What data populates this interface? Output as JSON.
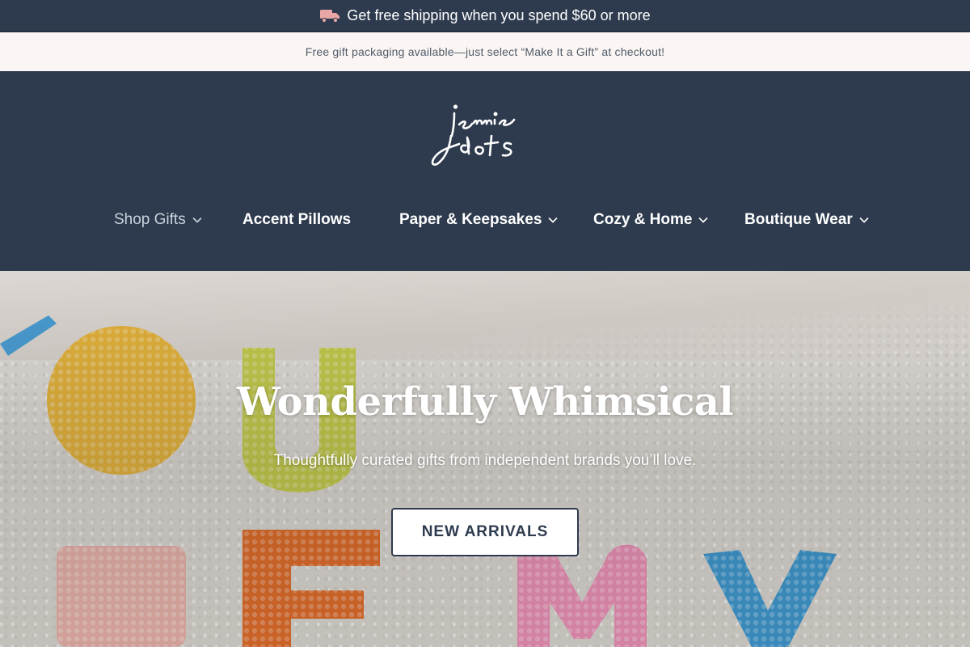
{
  "shipping_bar": {
    "icon": "truck-icon",
    "text": "Get free shipping when you spend $60 or more"
  },
  "gift_bar": {
    "text": "Free gift packaging available—just select “Make It a Gift” at checkout!"
  },
  "brand": {
    "logo_text": "jennie dots"
  },
  "nav": {
    "items": [
      {
        "label": "Shop Gifts",
        "has_dropdown": true
      },
      {
        "label": "Accent Pillows",
        "has_dropdown": false
      },
      {
        "label": "Paper & Keepsakes",
        "has_dropdown": true
      },
      {
        "label": "Cozy & Home",
        "has_dropdown": true
      },
      {
        "label": "Boutique Wear",
        "has_dropdown": true
      }
    ]
  },
  "hero": {
    "title": "Wonderfully Whimsical",
    "subtitle": "Thoughtfully curated gifts from independent brands you’ll love.",
    "cta_label": "NEW ARRIVALS"
  },
  "colors": {
    "navy": "#2e3b4e",
    "cream": "#fbf6f3",
    "white": "#ffffff",
    "accent_pink": "#e9a6a6"
  }
}
